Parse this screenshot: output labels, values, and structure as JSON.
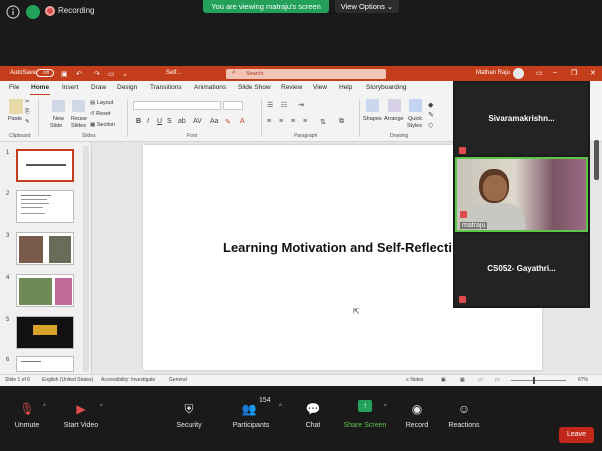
{
  "zoom": {
    "recording_label": "Recording",
    "viewing_banner": "You are viewing matraju's screen",
    "view_options": "View Options",
    "leave": "Leave",
    "toolbar": {
      "unmute": "Unmute",
      "start_video": "Start Video",
      "security": "Security",
      "participants": "Participants",
      "participant_count": "154",
      "chat": "Chat",
      "share_screen": "Share Screen",
      "record": "Record",
      "reactions": "Reactions"
    },
    "participants": [
      {
        "name": "Sivaramakrishn..."
      },
      {
        "name": "matraju"
      },
      {
        "name": "CS052- Gayathri..."
      }
    ]
  },
  "ppt": {
    "autosave": "AutoSave",
    "autosave_state": "Off",
    "doc_title": "Self...",
    "search_placeholder": "Search",
    "user": "Mathan Raju",
    "menu": [
      "File",
      "Home",
      "Insert",
      "Draw",
      "Design",
      "Transitions",
      "Animations",
      "Slide Show",
      "Review",
      "View",
      "Help",
      "Storyboarding"
    ],
    "ribbon": {
      "paste": "Paste",
      "clipboard": "Clipboard",
      "new_slide": "New",
      "new_slide2": "Slide",
      "reuse": "Reuse",
      "reuse2": "Slides",
      "layout": "Layout",
      "reset": "Reset",
      "section": "Section",
      "slides": "Slides",
      "font": "Font",
      "paragraph": "Paragraph",
      "shapes": "Shapes",
      "arrange": "Arrange",
      "quick_styles": "Quick",
      "quick_styles2": "Styles",
      "drawing": "Drawing",
      "fmt_b": "B",
      "fmt_i": "I",
      "fmt_u": "U",
      "fmt_s": "S"
    },
    "thumb_numbers": [
      "1",
      "2",
      "3",
      "4",
      "5",
      "6"
    ],
    "slide_title": "Learning Motivation and Self-Reflecti",
    "status": {
      "slide": "Slide 1 of 6",
      "language": "English (United States)",
      "accessibility": "Accessibility: Investigate",
      "general": "General",
      "notes": "Notes",
      "zoom": "67%"
    }
  }
}
